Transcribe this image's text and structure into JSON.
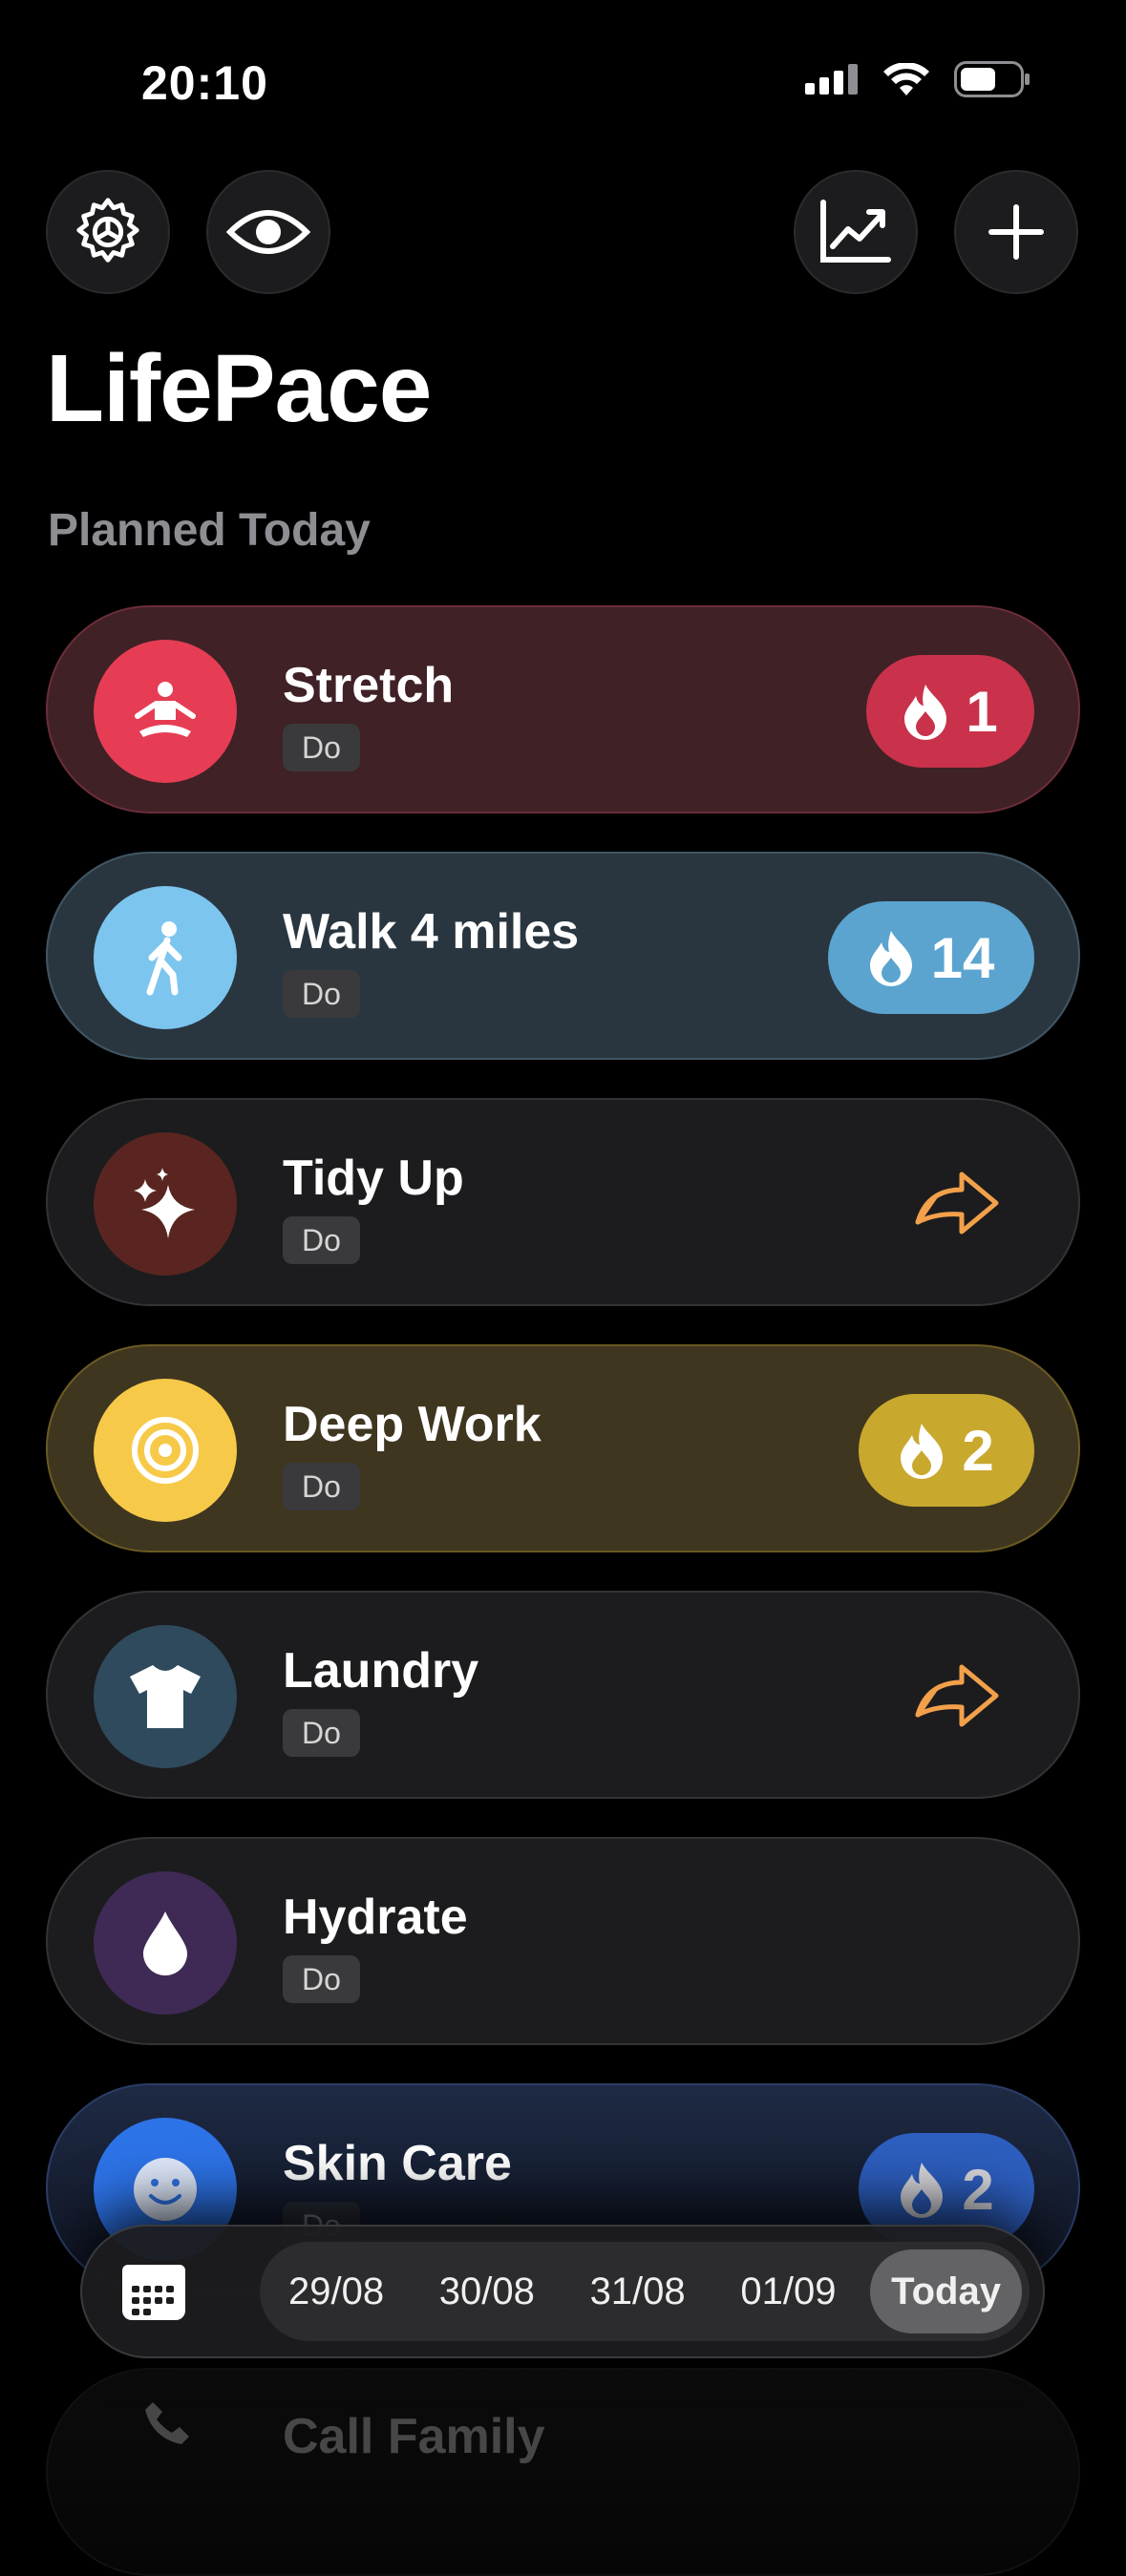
{
  "status": {
    "time": "20:10"
  },
  "toolbar": {
    "settings_icon": "gear-icon",
    "visibility_icon": "eye-icon",
    "stats_icon": "chart-icon",
    "add_icon": "plus-icon"
  },
  "app": {
    "title": "LifePace"
  },
  "section": {
    "title": "Planned Today"
  },
  "habits": [
    {
      "name": "Stretch",
      "tag": "Do",
      "icon": "yoga-icon",
      "streak": "1",
      "color": "#e63d55"
    },
    {
      "name": "Walk 4 miles",
      "tag": "Do",
      "icon": "walking-icon",
      "streak": "14",
      "color": "#7cc5ef"
    },
    {
      "name": "Tidy Up",
      "tag": "Do",
      "icon": "sparkles-icon",
      "action": "skip-arrow-icon",
      "color": "#5a2520"
    },
    {
      "name": "Deep Work",
      "tag": "Do",
      "icon": "target-icon",
      "streak": "2",
      "color": "#f7c948"
    },
    {
      "name": "Laundry",
      "tag": "Do",
      "icon": "tshirt-icon",
      "action": "skip-arrow-icon",
      "color": "#2f4a5c"
    },
    {
      "name": "Hydrate",
      "tag": "Do",
      "icon": "drop-icon",
      "color": "#3f2a55"
    },
    {
      "name": "Skin Care",
      "tag": "Do",
      "icon": "smiley-icon",
      "streak": "2",
      "color": "#2d73e8"
    },
    {
      "name": "Call Family",
      "icon": "phone-icon"
    }
  ],
  "date_bar": {
    "calendar_icon": "calendar-icon",
    "dates": [
      "29/08",
      "30/08",
      "31/08",
      "01/09",
      "Today"
    ],
    "selected": "Today"
  }
}
